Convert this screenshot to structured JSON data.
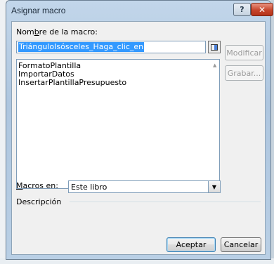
{
  "dialog": {
    "title": "Asignar macro",
    "help_label": "?",
    "close_label": "✕"
  },
  "form": {
    "name_label_before": "Nom",
    "name_label_accel": "b",
    "name_label_after": "re de la macro:",
    "name_value": "TriánguloIsósceles_Haga_clic_en",
    "macros": [
      "FormatoPlantilla",
      "ImportarDatos",
      "InsertarPlantillaPresupuesto"
    ],
    "macros_in_label_accel": "M",
    "macros_in_label_after": "acros en:",
    "macros_in_value": "Este libro",
    "description_label": "Descripción"
  },
  "buttons": {
    "modify": "Modificar",
    "record": "Grabar...",
    "ok": "Aceptar",
    "cancel": "Cancelar"
  },
  "icons": {
    "scroll_up": "▲",
    "scroll_down": "▼",
    "dropdown": "▼"
  }
}
